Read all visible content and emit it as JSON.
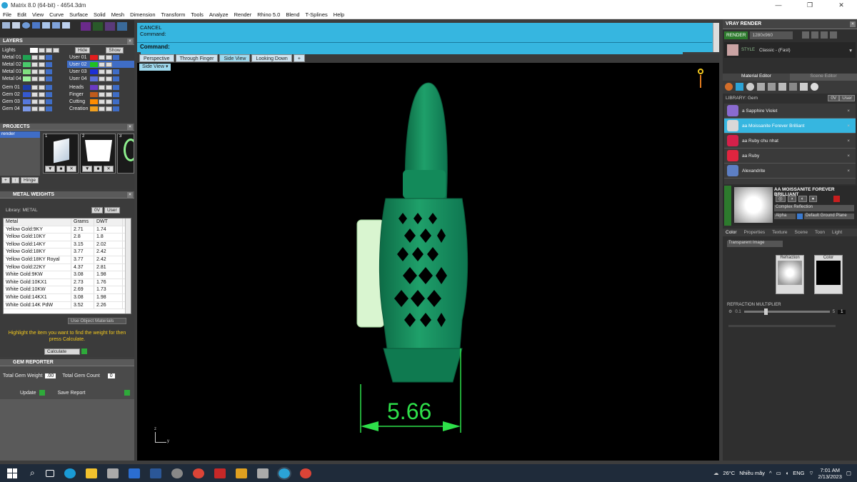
{
  "window": {
    "title": "Matrix 8.0 (64-bit) - 4654.3dm",
    "controls": [
      "—",
      "❐",
      "✕"
    ]
  },
  "menu": [
    "File",
    "Edit",
    "View",
    "Curve",
    "Surface",
    "Solid",
    "Mesh",
    "Dimension",
    "Transform",
    "Tools",
    "Analyze",
    "Render",
    "Rhino 5.0",
    "Blend",
    "T-Splines",
    "Help"
  ],
  "layers": {
    "title": "LAYERS",
    "lights": "Lights",
    "hide_label": "Hide",
    "show_label": "Show",
    "left": [
      {
        "name": "Metal 01",
        "color": "#1fa352"
      },
      {
        "name": "Metal 02",
        "color": "#49c96b"
      },
      {
        "name": "Metal 03",
        "color": "#7fe07f"
      },
      {
        "name": "Metal 04",
        "color": "#9cf29c"
      },
      {
        "name": "Gem 01",
        "color": "#1d3da8"
      },
      {
        "name": "Gem 02",
        "color": "#3559d0"
      },
      {
        "name": "Gem 03",
        "color": "#5577dd"
      },
      {
        "name": "Gem 04",
        "color": "#7b98e8"
      }
    ],
    "right": [
      {
        "name": "User 01",
        "color": "#e21d1d"
      },
      {
        "name": "User 02",
        "color": "#20c020"
      },
      {
        "name": "User 03",
        "color": "#1c2fd6"
      },
      {
        "name": "User 04",
        "color": "#5b6fd8"
      },
      {
        "name": "Heads",
        "color": "#6b3ac4"
      },
      {
        "name": "Finger",
        "color": "#c05b1c"
      },
      {
        "name": "Cutting",
        "color": "#ff8c00"
      },
      {
        "name": "Creation",
        "color": "#f0a020"
      }
    ]
  },
  "projects": {
    "title": "PROJECTS",
    "items": [
      "render"
    ],
    "thumbs": [
      "1",
      "2",
      "3"
    ],
    "hinge_label": "Hinge"
  },
  "metal_weights": {
    "title": "METAL WEIGHTS",
    "library_label": "Library: METAL",
    "headers": [
      "Metal",
      "Grams",
      "DWT"
    ],
    "rows": [
      [
        "Yellow Gold:9KY",
        "2.71",
        "1.74"
      ],
      [
        "Yellow Gold:10KY",
        "2.8",
        "1.8"
      ],
      [
        "Yellow Gold:14KY",
        "3.15",
        "2.02"
      ],
      [
        "Yellow Gold:18KY",
        "3.77",
        "2.42"
      ],
      [
        "Yellow Gold:18KY Royal",
        "3.77",
        "2.42"
      ],
      [
        "Yellow Gold:22KY",
        "4.37",
        "2.81"
      ],
      [
        "White Gold:9KW",
        "3.08",
        "1.98"
      ],
      [
        "White Gold:10KX1",
        "2.73",
        "1.76"
      ],
      [
        "White Gold:10KW",
        "2.69",
        "1.73"
      ],
      [
        "White Gold:14KX1",
        "3.08",
        "1.98"
      ],
      [
        "White Gold:14K PdW",
        "3.52",
        "2.26"
      ]
    ],
    "use_object_materials": "Use Object Materials",
    "hint": "Highlight the item you want to find the weight for then press Calculate.",
    "calculate": "Calculate"
  },
  "gem_reporter": {
    "title": "GEM REPORTER",
    "total_weight_label": "Total Gem Weight",
    "total_weight_value": ".00",
    "total_count_label": "Total Gem Count",
    "total_count_value": "0",
    "update": "Update",
    "save_report": "Save Report"
  },
  "command": {
    "line1": "CANCEL",
    "line2": "Command:",
    "prompt": "Command:"
  },
  "view_tabs": [
    "Perspective",
    "Through Finger",
    "Side View",
    "Looking Down",
    "+"
  ],
  "active_tab": "Side View",
  "viewport_label": "Side View",
  "dimension": {
    "value": "5.66"
  },
  "axes": {
    "z": "z",
    "y": "y"
  },
  "vray": {
    "title": "VRAY RENDER",
    "render_btn": "RENDER",
    "resolution": "1280x960",
    "style_label": "STYLE",
    "style_value": "Classic - (Fast)",
    "tabs": [
      "Material Editor",
      "Scene Editor"
    ],
    "library_label": "LIBRARY: Gem",
    "lib_0v": "0V",
    "lib_user": "User",
    "items": [
      {
        "name": "a Sapphire Violet",
        "color": "#8a6bd0"
      },
      {
        "name": "aa Moissanite Forever Brilliant",
        "color": "#d8d8d8"
      },
      {
        "name": "aa Ruby chu nhat",
        "color": "#d6204a"
      },
      {
        "name": "aa Ruby",
        "color": "#e0253f"
      },
      {
        "name": "Alexandrite",
        "color": "#5d7fc4"
      }
    ],
    "selected_material": "AA MOISSANITE FOREVER BRILLIANT",
    "complex_reflection": "Complex Reflection",
    "alpha": "Alpha",
    "ground_plane": "Default Ground Plane",
    "sub_tabs": [
      "Color",
      "Properties",
      "Texture",
      "Scene",
      "Toon",
      "Light"
    ],
    "transparent_image": "Transparent Image",
    "refraction": "Refraction",
    "color": "Color",
    "refraction_multiplier": "REFRACTION MULTIPLIER",
    "rm_min": "0.1",
    "rm_max": "5",
    "rm_value": "1"
  },
  "taskbar": {
    "weather_temp": "26°C",
    "weather_text": "Nhiều mây",
    "lang": "ENG",
    "time": "7:01 AM",
    "date": "2/13/2023"
  }
}
